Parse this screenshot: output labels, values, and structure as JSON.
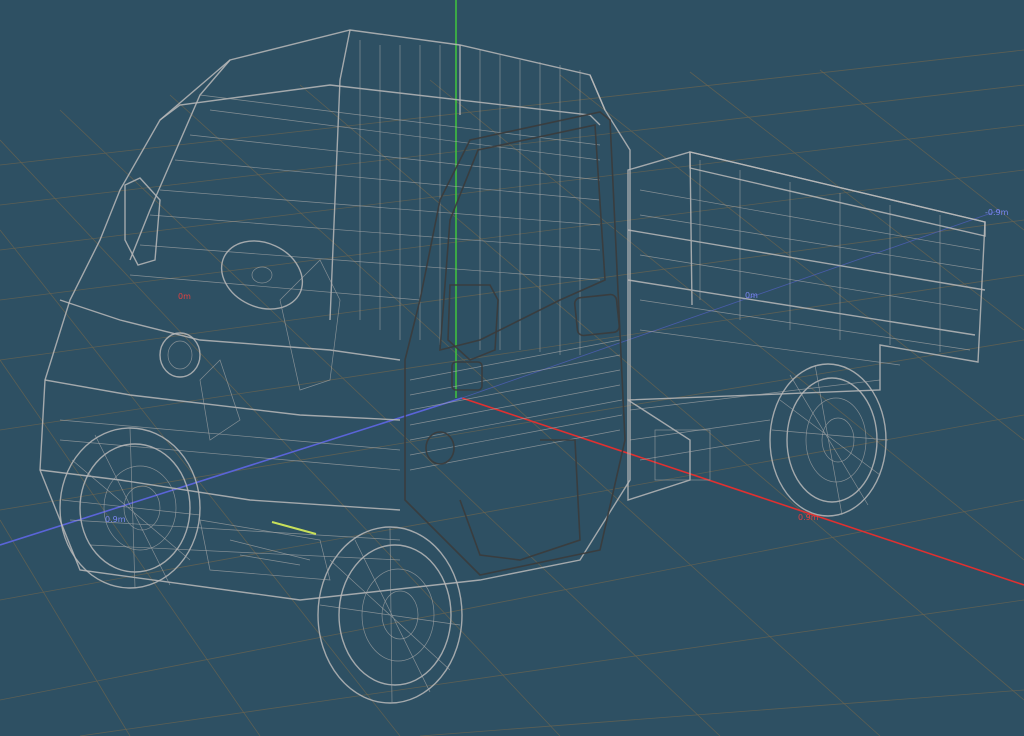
{
  "viewport": {
    "background_color": "#2e5063",
    "grid_color": "#6b6450",
    "wireframe_color": "#b9b9b9",
    "axis_colors": {
      "x": "#e03030",
      "y": "#3fbf3f",
      "z": "#5a64d8"
    }
  },
  "axis_labels": {
    "z_far": "-0.9m",
    "x_near": "0.9m",
    "x_small": "0m",
    "z_small": "0m",
    "z_near": "0.9m"
  },
  "model": {
    "icon": "kei-truck-wireframe-icon"
  }
}
